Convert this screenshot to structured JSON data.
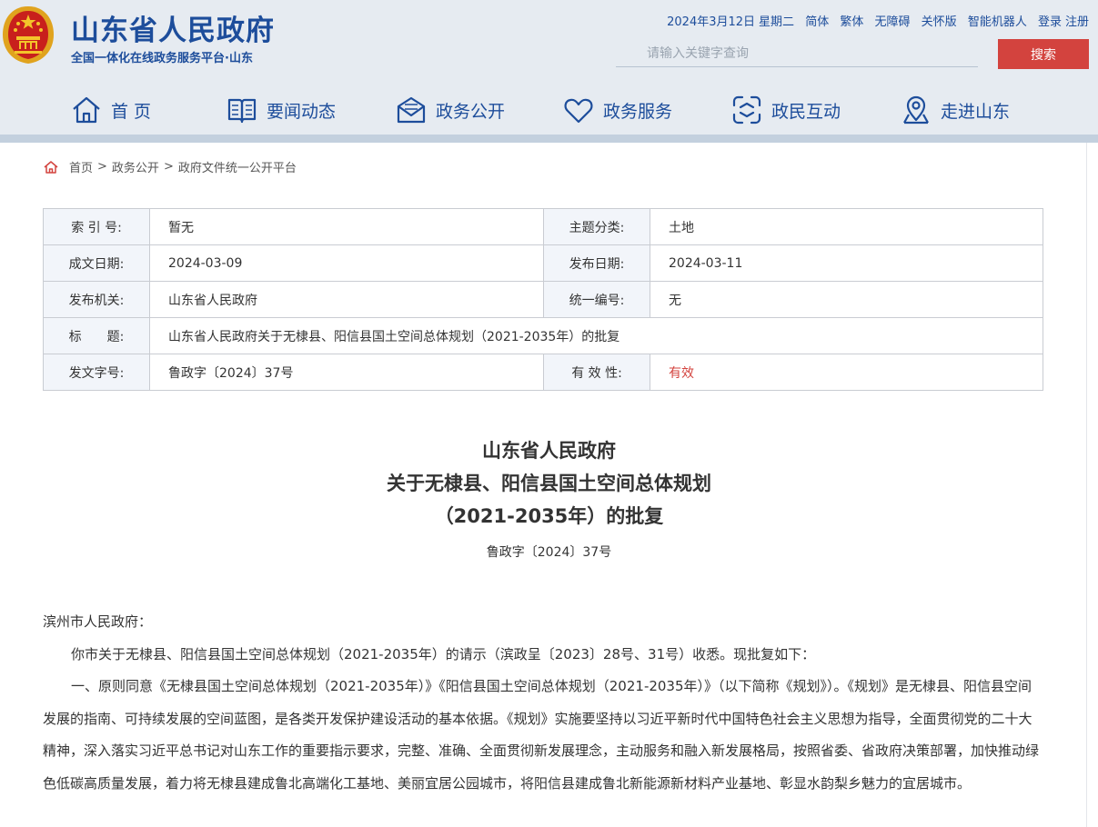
{
  "header": {
    "site_title": "山东省人民政府",
    "site_subtitle": "全国一体化在线政务服务平台·山东",
    "date": "2024年3月12日",
    "weekday": "星期二",
    "links": [
      "简体",
      "繁体",
      "无障碍",
      "关怀版",
      "智能机器人"
    ],
    "login": "登录",
    "register": "注册",
    "search_placeholder": "请输入关键字查询",
    "search_button": "搜索",
    "colors": {
      "brand_blue": "#1d4d9b",
      "search_red": "#d3433e",
      "header_bg": "#e6ebf1"
    }
  },
  "nav": [
    {
      "label": "首 页",
      "icon": "home-icon"
    },
    {
      "label": "要闻动态",
      "icon": "book-icon"
    },
    {
      "label": "政务公开",
      "icon": "mail-icon"
    },
    {
      "label": "政务服务",
      "icon": "heart-icon"
    },
    {
      "label": "政民互动",
      "icon": "interact-icon"
    },
    {
      "label": "走进山东",
      "icon": "map-pin-icon"
    }
  ],
  "breadcrumb": [
    "首页",
    "政务公开",
    "政府文件统一公开平台"
  ],
  "breadcrumb_sep": ">",
  "meta": {
    "index_label": "索 引 号:",
    "index_value": "暂无",
    "category_label": "主题分类:",
    "category_value": "土地",
    "written_label": "成文日期:",
    "written_value": "2024-03-09",
    "published_label": "发布日期:",
    "published_value": "2024-03-11",
    "issuer_label": "发布机关:",
    "issuer_value": "山东省人民政府",
    "code_label": "统一编号:",
    "code_value": "无",
    "title_label": "标　　题:",
    "title_value": "山东省人民政府关于无棣县、阳信县国土空间总体规划（2021-2035年）的批复",
    "docno_label": "发文字号:",
    "docno_value": "鲁政字〔2024〕37号",
    "validity_label": "有 效 性:",
    "validity_value": "有效"
  },
  "document": {
    "title_line1": "山东省人民政府",
    "title_line2": "关于无棣县、阳信县国土空间总体规划",
    "title_line3": "（2021-2035年）的批复",
    "number": "鲁政字〔2024〕37号",
    "salutation": "滨州市人民政府：",
    "paragraph1": "你市关于无棣县、阳信县国土空间总体规划（2021-2035年）的请示（滨政呈〔2023〕28号、31号）收悉。现批复如下：",
    "paragraph2": "一、原则同意《无棣县国土空间总体规划（2021-2035年）》《阳信县国土空间总体规划（2021-2035年）》（以下简称《规划》）。《规划》是无棣县、阳信县空间发展的指南、可持续发展的空间蓝图，是各类开发保护建设活动的基本依据。《规划》实施要坚持以习近平新时代中国特色社会主义思想为指导，全面贯彻党的二十大精神，深入落实习近平总书记对山东工作的重要指示要求，完整、准确、全面贯彻新发展理念，主动服务和融入新发展格局，按照省委、省政府决策部署，加快推动绿色低碳高质量发展，着力将无棣县建成鲁北高端化工基地、美丽宜居公园城市，将阳信县建成鲁北新能源新材料产业基地、彰显水韵梨乡魅力的宜居城市。"
  }
}
